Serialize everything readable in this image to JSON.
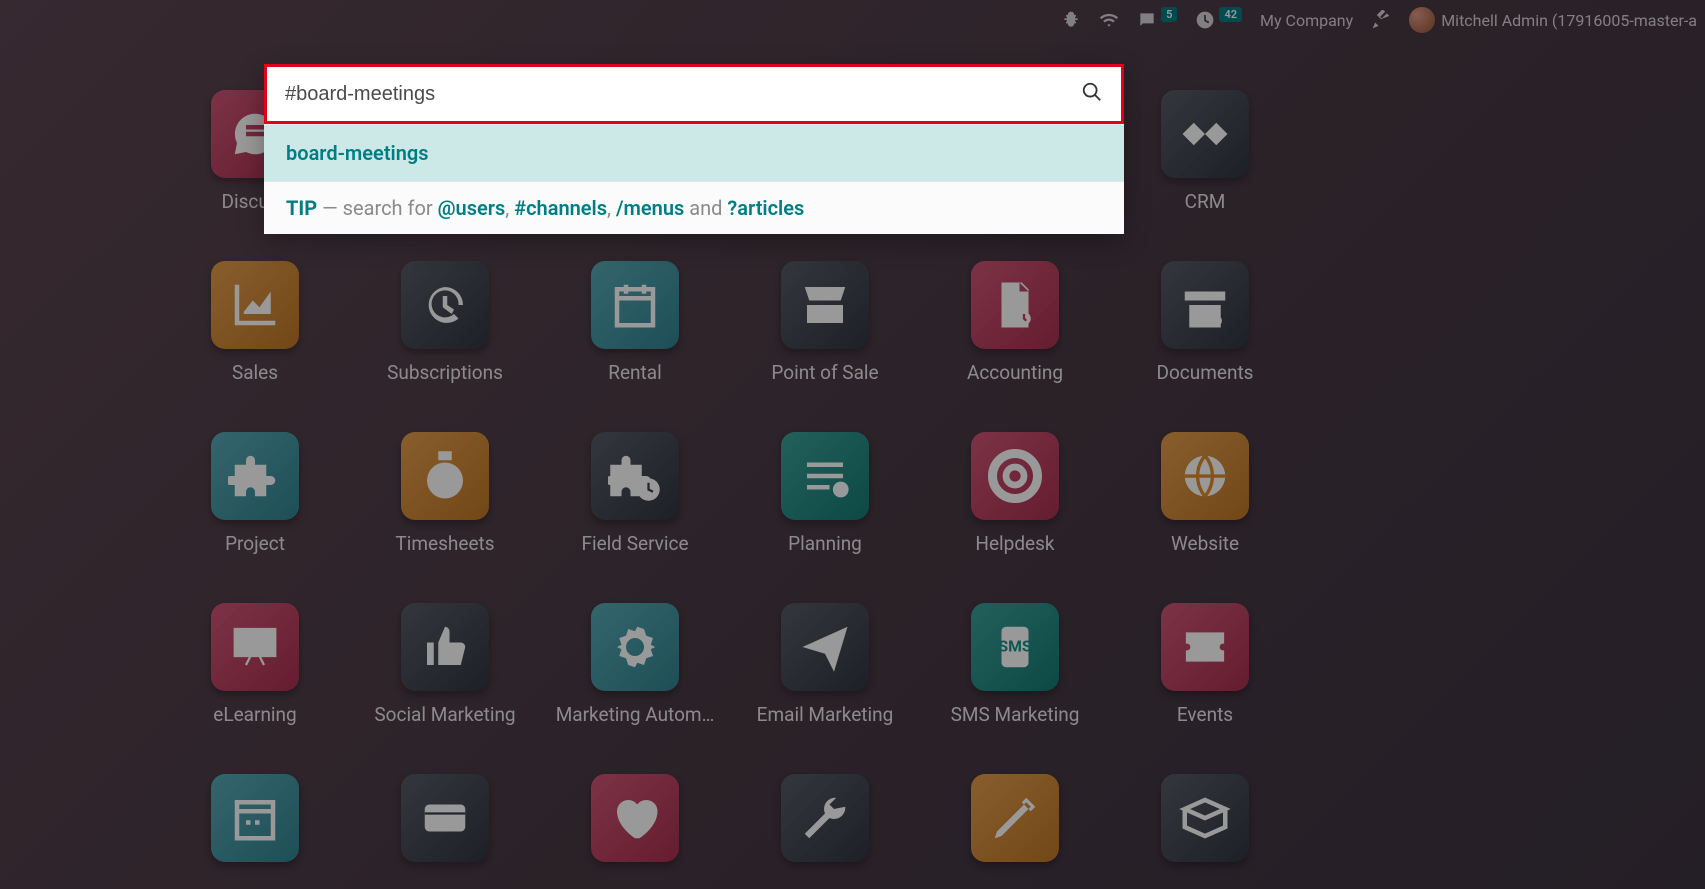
{
  "topbar": {
    "messages_badge": "5",
    "clock_badge": "42",
    "company": "My Company",
    "user": "Mitchell Admin (17916005-master-a"
  },
  "search": {
    "value": "#board-meetings",
    "result": "board-meetings",
    "tip_label": "TIP",
    "tip_sep": " — search for ",
    "tip_users": "@users",
    "tip_c1": ", ",
    "tip_channels": "#channels",
    "tip_c2": ", ",
    "tip_menus": "/menus",
    "tip_c3": " and ",
    "tip_articles": "?articles"
  },
  "apps": [
    {
      "label": "Discuss",
      "color": "#c8385e",
      "icon": "chat"
    },
    {
      "label": "",
      "color": "",
      "icon": ""
    },
    {
      "label": "",
      "color": "",
      "icon": ""
    },
    {
      "label": "",
      "color": "",
      "icon": ""
    },
    {
      "label": "",
      "color": "",
      "icon": ""
    },
    {
      "label": "CRM",
      "color": "#3a3f4b",
      "icon": "handshake"
    },
    {
      "label": "Sales",
      "color": "#e08b2c",
      "icon": "chart"
    },
    {
      "label": "Subscriptions",
      "color": "#3a3f4b",
      "icon": "cycle"
    },
    {
      "label": "Rental",
      "color": "#3b9aa8",
      "icon": "calendar"
    },
    {
      "label": "Point of Sale",
      "color": "#3a3f4b",
      "icon": "store"
    },
    {
      "label": "Accounting",
      "color": "#c8385e",
      "icon": "doc"
    },
    {
      "label": "Documents",
      "color": "#3a3f4b",
      "icon": "box"
    },
    {
      "label": "Project",
      "color": "#3b9aa8",
      "icon": "puzzle"
    },
    {
      "label": "Timesheets",
      "color": "#e08b2c",
      "icon": "stopwatch"
    },
    {
      "label": "Field Service",
      "color": "#3a3f4b",
      "icon": "puzzle-time"
    },
    {
      "label": "Planning",
      "color": "#1a8f86",
      "icon": "list"
    },
    {
      "label": "Helpdesk",
      "color": "#c8385e",
      "icon": "lifebuoy"
    },
    {
      "label": "Website",
      "color": "#e08b2c",
      "icon": "globe"
    },
    {
      "label": "eLearning",
      "color": "#c8385e",
      "icon": "board"
    },
    {
      "label": "Social Marketing",
      "color": "#3a3f4b",
      "icon": "thumb"
    },
    {
      "label": "Marketing Autom…",
      "color": "#3b9aa8",
      "icon": "gear"
    },
    {
      "label": "Email Marketing",
      "color": "#3a3f4b",
      "icon": "plane"
    },
    {
      "label": "SMS Marketing",
      "color": "#1a8f86",
      "icon": "sms"
    },
    {
      "label": "Events",
      "color": "#c8385e",
      "icon": "ticket"
    },
    {
      "label": "",
      "color": "#3b9aa8",
      "icon": "cal2"
    },
    {
      "label": "",
      "color": "#3a3f4b",
      "icon": "card"
    },
    {
      "label": "",
      "color": "#c8385e",
      "icon": "heart"
    },
    {
      "label": "",
      "color": "#3a3f4b",
      "icon": "wrench"
    },
    {
      "label": "",
      "color": "#e08b2c",
      "icon": "pencil"
    },
    {
      "label": "",
      "color": "#3a3f4b",
      "icon": "openbox"
    }
  ]
}
